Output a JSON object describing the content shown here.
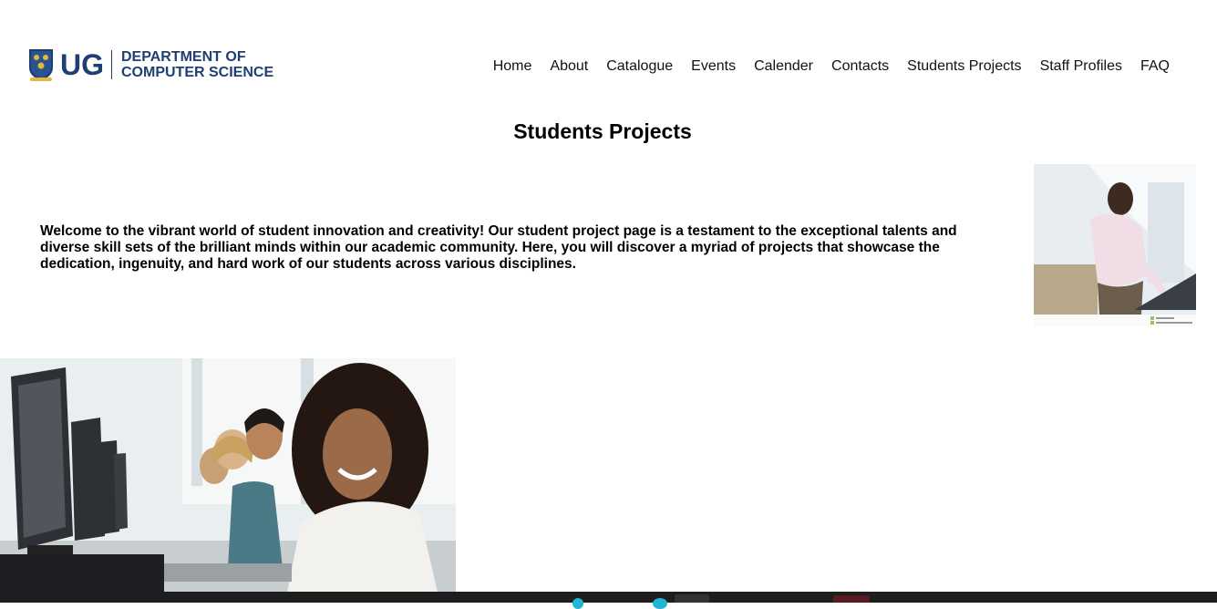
{
  "header": {
    "logo_abbr": "UG",
    "dept_line1": "DEPARTMENT OF",
    "dept_line2": "COMPUTER SCIENCE",
    "nav": [
      "Home",
      "About",
      "Catalogue",
      "Events",
      "Calender",
      "Contacts",
      "Students Projects",
      "Staff Profiles",
      "FAQ"
    ]
  },
  "main": {
    "title": "Students Projects",
    "intro": "Welcome to the vibrant world of student innovation and creativity! Our student project page is a testament to the exceptional talents and diverse skill sets of the brilliant minds within our academic community. Here, you will discover a myriad of projects that showcase the dedication, ingenuity, and hard work of our students across various disciplines."
  },
  "colors": {
    "brand": "#1f3f73",
    "taskbar": "#1e1e1e",
    "taskbar_accent": "#23b5d6"
  }
}
